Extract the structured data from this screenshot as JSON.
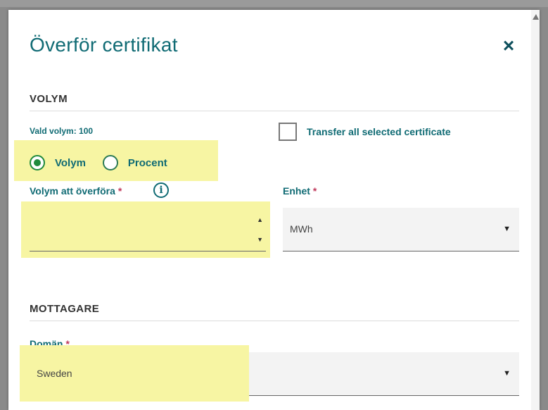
{
  "dialog": {
    "title": "Överför certifikat",
    "close_symbol": "×"
  },
  "volume_section": {
    "heading": "VOLYM",
    "selected_volume_text": "Vald volym: 100",
    "transfer_all_label": "Transfer all selected certificate",
    "transfer_all_checked": false,
    "radio_options": [
      {
        "label": "Volym",
        "checked": true
      },
      {
        "label": "Procent",
        "checked": false
      }
    ],
    "amount_label": "Volym att överföra",
    "amount_required": "*",
    "amount_value": "",
    "unit_label": "Enhet",
    "unit_required": "*",
    "unit_value": "MWh"
  },
  "recipient_section": {
    "heading": "MOTTAGARE",
    "domain_label": "Domän",
    "domain_required": "*",
    "domain_value": "Sweden"
  },
  "icons": {
    "info": "i",
    "spin_up": "▲",
    "spin_down": "▼",
    "select_arrow": "▼"
  },
  "colors": {
    "accent": "#106b74",
    "radio": "#1f8a3c",
    "required": "#c0395b",
    "highlight": "#f7f5a3"
  }
}
